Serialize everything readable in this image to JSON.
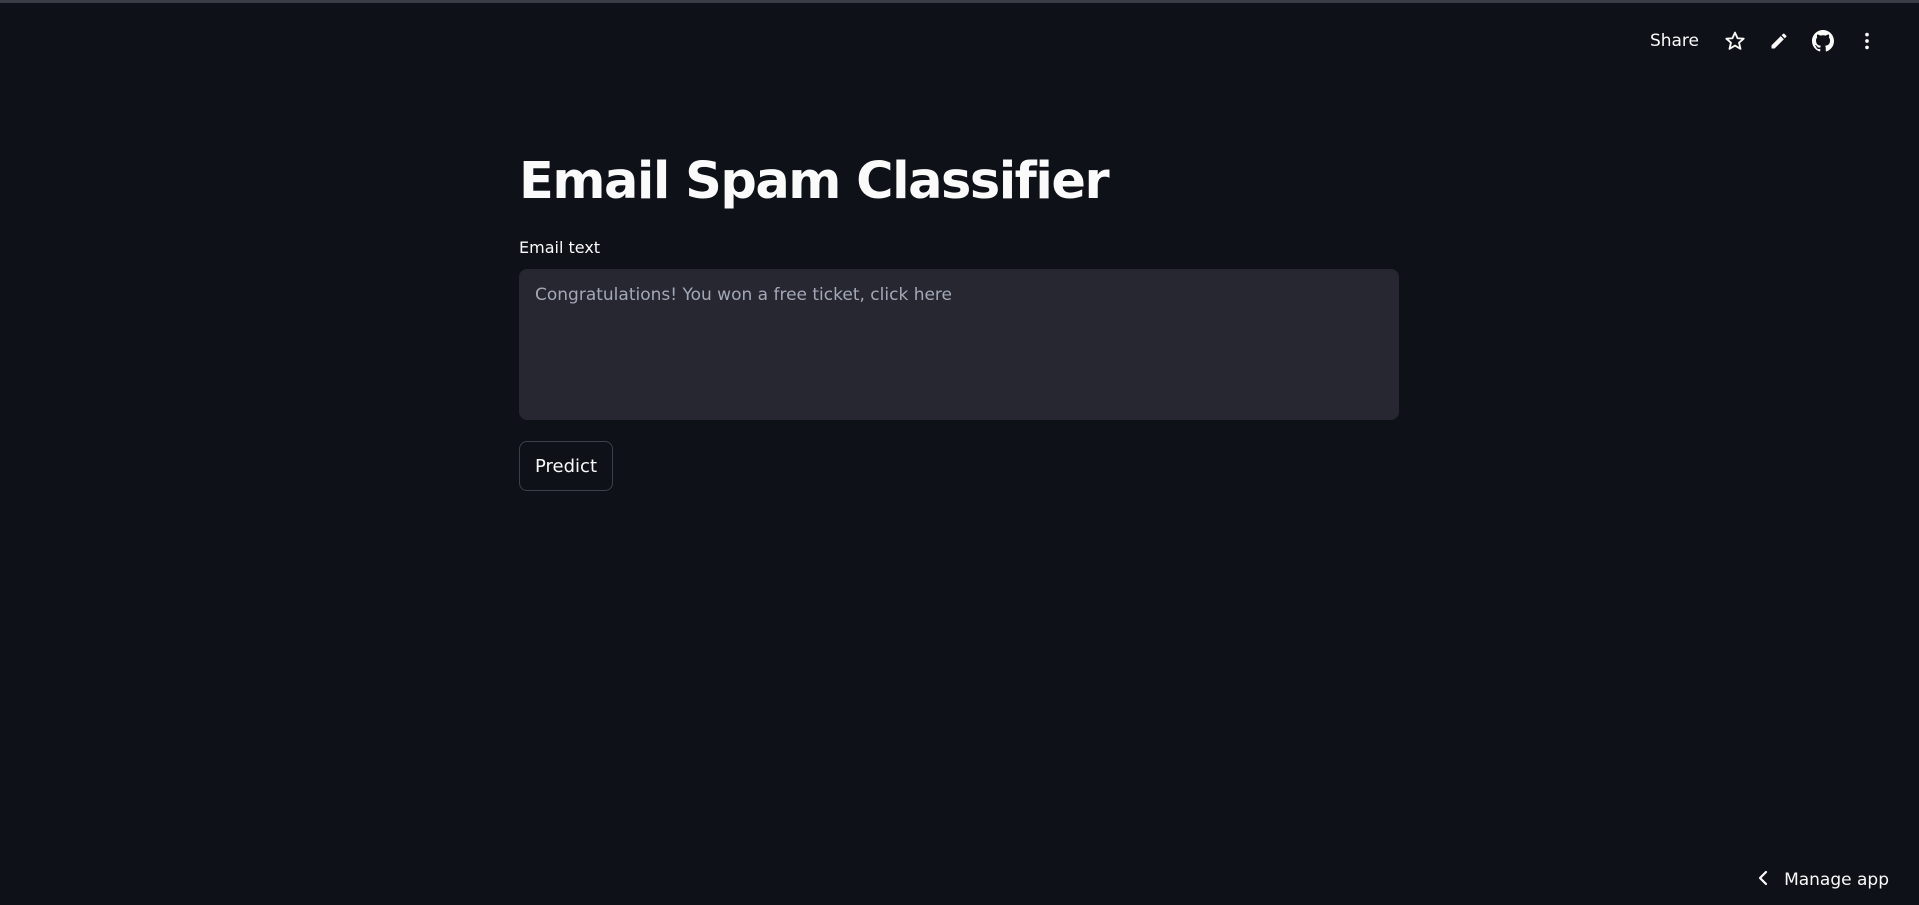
{
  "toolbar": {
    "share_label": "Share",
    "icons": [
      "star-icon",
      "pencil-icon",
      "github-icon",
      "more-vertical-icon"
    ]
  },
  "main": {
    "title": "Email Spam Classifier",
    "email_field": {
      "label": "Email text",
      "value": "",
      "placeholder": "Congratulations! You won a free ticket, click here"
    },
    "predict_label": "Predict"
  },
  "footer": {
    "manage_label": "Manage app",
    "icon": "chevron-left-icon"
  },
  "colors": {
    "background": "#0e1117",
    "input_background": "#262730",
    "text": "#fafafa",
    "placeholder": "#a3a8b8",
    "border": "#3d404a"
  }
}
